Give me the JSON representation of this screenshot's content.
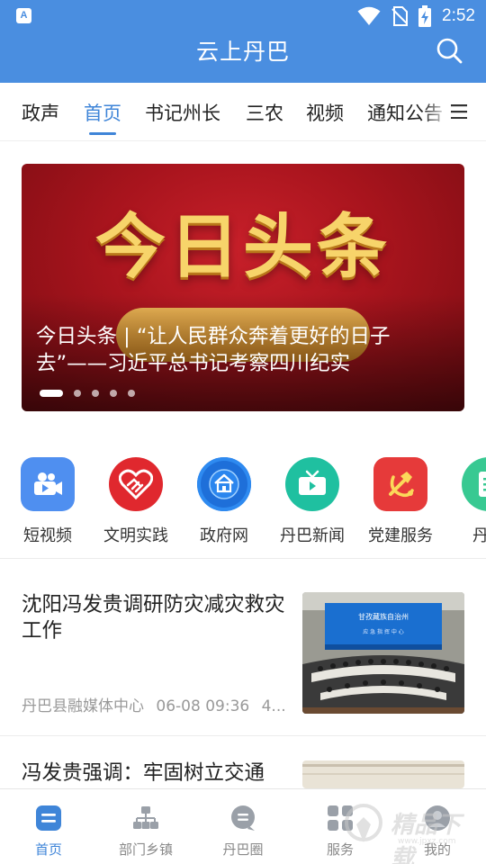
{
  "status_bar": {
    "app_badge": "A",
    "time": "2:52"
  },
  "header": {
    "title": "云上丹巴"
  },
  "tabs": [
    {
      "label": "政声"
    },
    {
      "label": "首页"
    },
    {
      "label": "书记州长"
    },
    {
      "label": "三农"
    },
    {
      "label": "视频"
    },
    {
      "label": "通知公告"
    }
  ],
  "active_tab": "首页",
  "banner": {
    "headline": "今日头条",
    "caption": "今日头条 | “让人民群众奔着更好的日子去”——习近平总书记考察四川纪实",
    "slide_count": 5,
    "active_slide": 1
  },
  "shortcuts": [
    {
      "label": "短视频",
      "icon": "video-camera-icon",
      "color": "#4f8ff0"
    },
    {
      "label": "文明实践",
      "icon": "heart-handshake-icon",
      "color": "#e0282e"
    },
    {
      "label": "政府网",
      "icon": "home-globe-icon",
      "color": "#1e6fd9"
    },
    {
      "label": "丹巴新闻",
      "icon": "tv-icon",
      "color": "#1fc0a0"
    },
    {
      "label": "党建服务",
      "icon": "party-emblem-icon",
      "color": "#e63a3a"
    },
    {
      "label": "丹巴",
      "icon": "document-icon",
      "color": "#38c992"
    }
  ],
  "news": [
    {
      "title": "沈阳冯发贵调研防灾减灾救灾工作",
      "source": "丹巴县融媒体中心",
      "time": "06-08 09:36",
      "extra": "4...",
      "thumb_banner": "甘孜藏族自治州 应急指挥中心"
    },
    {
      "title": "冯发贵强调：牢固树立交通"
    }
  ],
  "bottom_nav": [
    {
      "label": "首页",
      "icon": "home-tab-icon",
      "active": true
    },
    {
      "label": "部门乡镇",
      "icon": "org-chart-icon",
      "active": false
    },
    {
      "label": "丹巴圈",
      "icon": "chat-circle-icon",
      "active": false
    },
    {
      "label": "服务",
      "icon": "grid-icon",
      "active": false
    },
    {
      "label": "我的",
      "icon": "avatar-icon",
      "active": false
    }
  ],
  "watermark": {
    "text": "精品下载",
    "url": "www.jpxz.com"
  },
  "colors": {
    "header": "#4a8ee0",
    "accent": "#3f85d8",
    "muted": "#999999"
  }
}
